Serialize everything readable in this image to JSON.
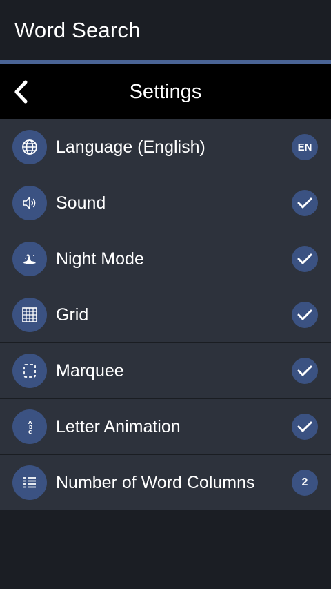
{
  "app": {
    "title": "Word Search"
  },
  "header": {
    "title": "Settings",
    "back_icon": "chevron-left-icon"
  },
  "colors": {
    "background": "#1b1e24",
    "accent": "#4a6496",
    "row_bg": "#2d323c",
    "icon_circle": "#3b5282",
    "text": "#ffffff"
  },
  "settings": [
    {
      "label": "Language (English)",
      "icon": "globe-icon",
      "value": "EN",
      "type": "badge"
    },
    {
      "label": "Sound",
      "icon": "speaker-icon",
      "value": "checked",
      "type": "check"
    },
    {
      "label": "Night Mode",
      "icon": "witch-hat-icon",
      "value": "checked",
      "type": "check"
    },
    {
      "label": "Grid",
      "icon": "grid-icon",
      "value": "checked",
      "type": "check"
    },
    {
      "label": "Marquee",
      "icon": "marquee-icon",
      "value": "checked",
      "type": "check"
    },
    {
      "label": "Letter Animation",
      "icon": "letter-animation-icon",
      "value": "checked",
      "type": "check"
    },
    {
      "label": "Number of Word Columns",
      "icon": "columns-icon",
      "value": "2",
      "type": "badge"
    }
  ]
}
